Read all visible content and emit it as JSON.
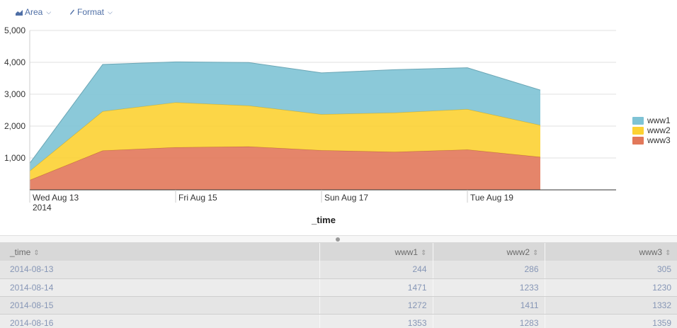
{
  "toolbar": {
    "area_label": "Area",
    "format_label": "Format"
  },
  "legend": [
    {
      "label": "www1",
      "color": "#7ec3d5"
    },
    {
      "label": "www2",
      "color": "#fcd233"
    },
    {
      "label": "www3",
      "color": "#e2785a"
    }
  ],
  "chart_data": {
    "type": "area",
    "stacked": true,
    "xlabel": "_time",
    "ylabel": "",
    "ylim": [
      0,
      5000
    ],
    "y_ticks": [
      "1,000",
      "2,000",
      "3,000",
      "4,000",
      "5,000"
    ],
    "x_tick_labels": [
      {
        "day": 0,
        "lines": [
          "Wed Aug 13",
          "2014"
        ]
      },
      {
        "day": 2,
        "lines": [
          "Fri Aug 15"
        ]
      },
      {
        "day": 4,
        "lines": [
          "Sun Aug 17"
        ]
      },
      {
        "day": 6,
        "lines": [
          "Tue Aug 19"
        ]
      }
    ],
    "x": [
      "2014-08-13",
      "2014-08-14",
      "2014-08-15",
      "2014-08-16",
      "2014-08-17",
      "2014-08-18",
      "2014-08-19",
      "2014-08-20"
    ],
    "series": [
      {
        "name": "www1",
        "color": "#7ec3d5",
        "values": [
          244,
          1471,
          1272,
          1353,
          1300,
          1350,
          1300,
          1100
        ]
      },
      {
        "name": "www2",
        "color": "#fcd233",
        "values": [
          286,
          1233,
          1411,
          1283,
          1130,
          1230,
          1270,
          1000
        ]
      },
      {
        "name": "www3",
        "color": "#e2785a",
        "values": [
          305,
          1230,
          1332,
          1359,
          1240,
          1190,
          1260,
          1030
        ]
      }
    ],
    "grid": true,
    "legend_position": "right"
  },
  "table": {
    "columns": [
      "_time",
      "www1",
      "www2",
      "www3"
    ],
    "rows": [
      [
        "2014-08-13",
        "244",
        "286",
        "305"
      ],
      [
        "2014-08-14",
        "1471",
        "1233",
        "1230"
      ],
      [
        "2014-08-15",
        "1272",
        "1411",
        "1332"
      ],
      [
        "2014-08-16",
        "1353",
        "1283",
        "1359"
      ]
    ]
  }
}
